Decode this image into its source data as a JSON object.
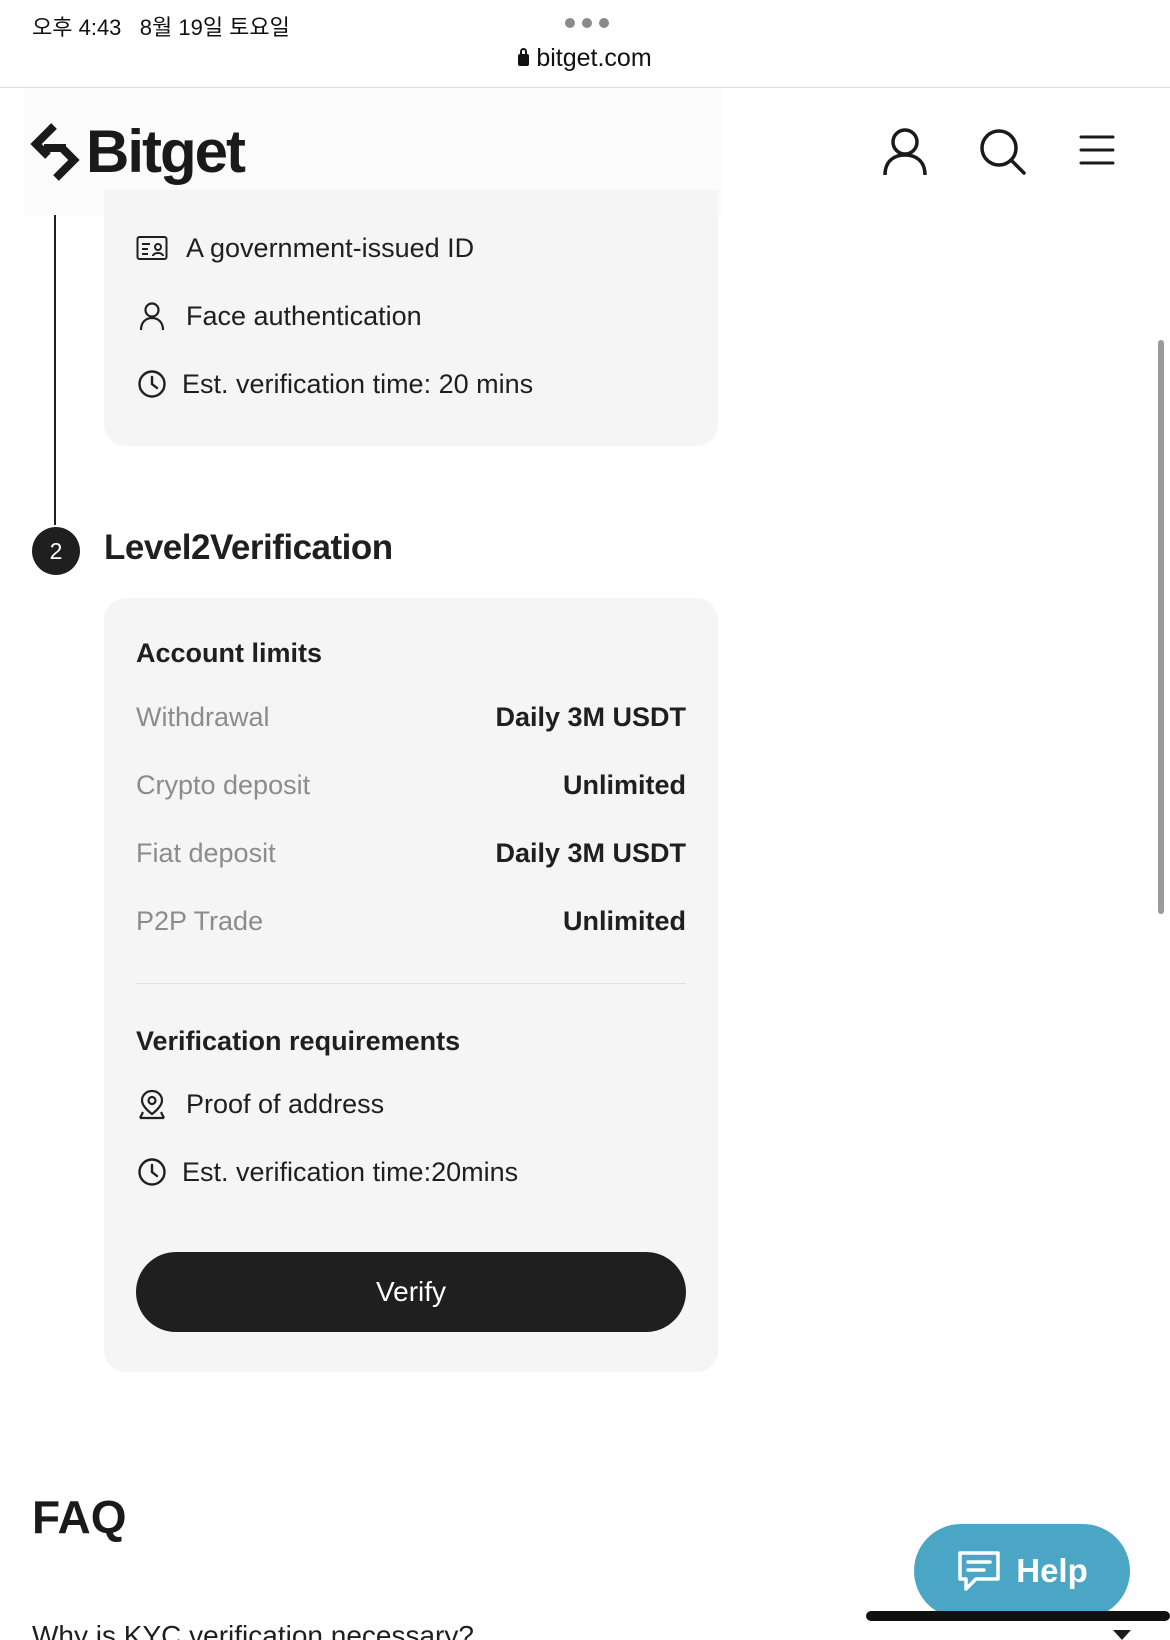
{
  "status_bar": {
    "time": "오후 4:43",
    "date": "8월 19일 토요일"
  },
  "browser": {
    "url": "bitget.com"
  },
  "header": {
    "logo_text": "Bitget",
    "icons": [
      "account-icon",
      "search-icon",
      "menu-icon"
    ]
  },
  "level1": {
    "requirements": [
      {
        "icon": "id-card-icon",
        "text": "A government-issued ID"
      },
      {
        "icon": "person-icon",
        "text": "Face authentication"
      },
      {
        "icon": "clock-icon",
        "text": "Est. verification time: 20 mins"
      }
    ]
  },
  "level2": {
    "step_number": "2",
    "title": "Level2Verification",
    "limits_title": "Account limits",
    "limits": [
      {
        "label": "Withdrawal",
        "value": "Daily 3M USDT"
      },
      {
        "label": "Crypto deposit",
        "value": "Unlimited"
      },
      {
        "label": "Fiat deposit",
        "value": "Daily 3M USDT"
      },
      {
        "label": "P2P Trade",
        "value": "Unlimited"
      }
    ],
    "requirements_title": "Verification requirements",
    "requirements": [
      {
        "icon": "location-pin-icon",
        "text": "Proof of address"
      },
      {
        "icon": "clock-icon",
        "text": "Est. verification time:20mins"
      }
    ],
    "verify_label": "Verify"
  },
  "faq": {
    "title": "FAQ",
    "first_question": "Why is KYC verification necessary?"
  },
  "help": {
    "label": "Help",
    "icon": "chat-icon"
  },
  "colors": {
    "dark": "#1f1f1f",
    "card_bg": "#f5f5f5",
    "help_bg": "#4aa6c4",
    "muted": "#8c8c8c"
  }
}
